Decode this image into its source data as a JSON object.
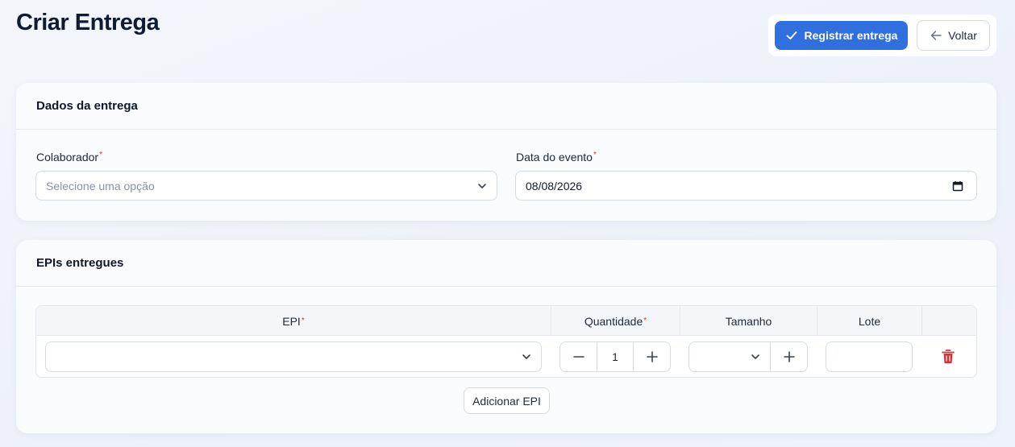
{
  "page": {
    "title": "Criar Entrega"
  },
  "actions": {
    "register_label": "Registrar entrega",
    "back_label": "Voltar"
  },
  "delivery": {
    "section_title": "Dados da entrega",
    "collaborator": {
      "label": "Colaborador",
      "placeholder": "Selecione uma opção",
      "value": ""
    },
    "event_date": {
      "label": "Data do evento",
      "value": "08/08/2026"
    },
    "required_mark": "*"
  },
  "epis": {
    "section_title": "EPIs entregues",
    "columns": [
      {
        "label": "EPI",
        "required": true
      },
      {
        "label": "Quantidade",
        "required": true
      },
      {
        "label": "Tamanho",
        "required": false
      },
      {
        "label": "Lote",
        "required": false
      }
    ],
    "rows": [
      {
        "epi": "",
        "quantity": "1",
        "size": "",
        "lot": ""
      }
    ],
    "add_label": "Adicionar EPI"
  },
  "colors": {
    "primary": "#2f6fdf",
    "danger": "#d63333",
    "required": "#e03131"
  },
  "icons": [
    "check-icon",
    "arrow-left-icon",
    "chevron-down-icon",
    "calendar-icon",
    "minus-icon",
    "plus-icon",
    "trash-icon"
  ]
}
